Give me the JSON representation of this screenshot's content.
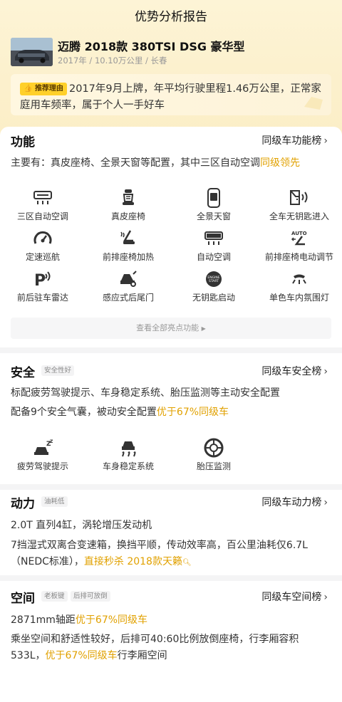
{
  "header": {
    "title": "优势分析报告"
  },
  "car": {
    "name": "迈腾 2018款 380TSI DSG 豪华型",
    "meta": "2017年 / 10.10万公里 / 长春"
  },
  "recommend": {
    "badge": "推荐理由",
    "text": "2017年9月上牌，年平均行驶里程1.46万公里，正常家庭用车频率，属于个人一手好车"
  },
  "function": {
    "title": "功能",
    "link": "同级车功能榜",
    "summary_a": "主要有：真皮座椅、全景天窗等配置，其中三区自动空调",
    "summary_hl": "同级领先",
    "items": [
      {
        "label": "三区自动空调",
        "icon": "climate-control-icon"
      },
      {
        "label": "真皮座椅",
        "icon": "leather-seat-icon"
      },
      {
        "label": "全景天窗",
        "icon": "panoramic-sunroof-icon"
      },
      {
        "label": "全车无钥匙进入",
        "icon": "keyless-entry-icon"
      },
      {
        "label": "定速巡航",
        "icon": "cruise-control-icon"
      },
      {
        "label": "前排座椅加热",
        "icon": "seat-heating-icon"
      },
      {
        "label": "自动空调",
        "icon": "auto-ac-icon"
      },
      {
        "label": "前排座椅电动调节",
        "icon": "power-seat-icon"
      },
      {
        "label": "前后驻车雷达",
        "icon": "parking-radar-icon"
      },
      {
        "label": "感应式后尾门",
        "icon": "power-tailgate-icon"
      },
      {
        "label": "无钥匙启动",
        "icon": "keyless-start-icon"
      },
      {
        "label": "单色车内氛围灯",
        "icon": "ambient-light-icon"
      }
    ],
    "more": "查看全部亮点功能"
  },
  "safety": {
    "title": "安全",
    "tag": "安全性好",
    "link": "同级车安全榜",
    "line1": "标配疲劳驾驶提示、车身稳定系统、胎压监测等主动安全配置",
    "line2_a": "配备9个安全气囊，被动安全配置",
    "line2_hl": "优于67%同级车",
    "items": [
      {
        "label": "疲劳驾驶提示",
        "icon": "fatigue-warning-icon"
      },
      {
        "label": "车身稳定系统",
        "icon": "stability-control-icon"
      },
      {
        "label": "胎压监测",
        "icon": "tire-pressure-icon"
      }
    ]
  },
  "power": {
    "title": "动力",
    "tag": "油耗低",
    "link": "同级车动力榜",
    "line1": "2.0T 直列4缸，涡轮增压发动机",
    "line2_a": "7挡湿式双离合变速箱，换挡平顺，传动效率高，百公里油耗仅6.7L（NEDC标准），",
    "line2_hl": "直接秒杀 2018款天籁"
  },
  "space": {
    "title": "空间",
    "tags": [
      "老板键",
      "后排可放倒"
    ],
    "link": "同级车空间榜",
    "line1_a": "2871mm轴距",
    "line1_hl": "优于67%同级车",
    "line2_a": "乘坐空间和舒适性较好，后排可40:60比例放倒座椅，行李厢容积533L，",
    "line2_hl": "优于67%同级车",
    "line2_b": "行李厢空间"
  },
  "colors": {
    "accent": "#e1a100",
    "badge": "#ffd02a",
    "hero_bg": "#fdf4d6"
  }
}
